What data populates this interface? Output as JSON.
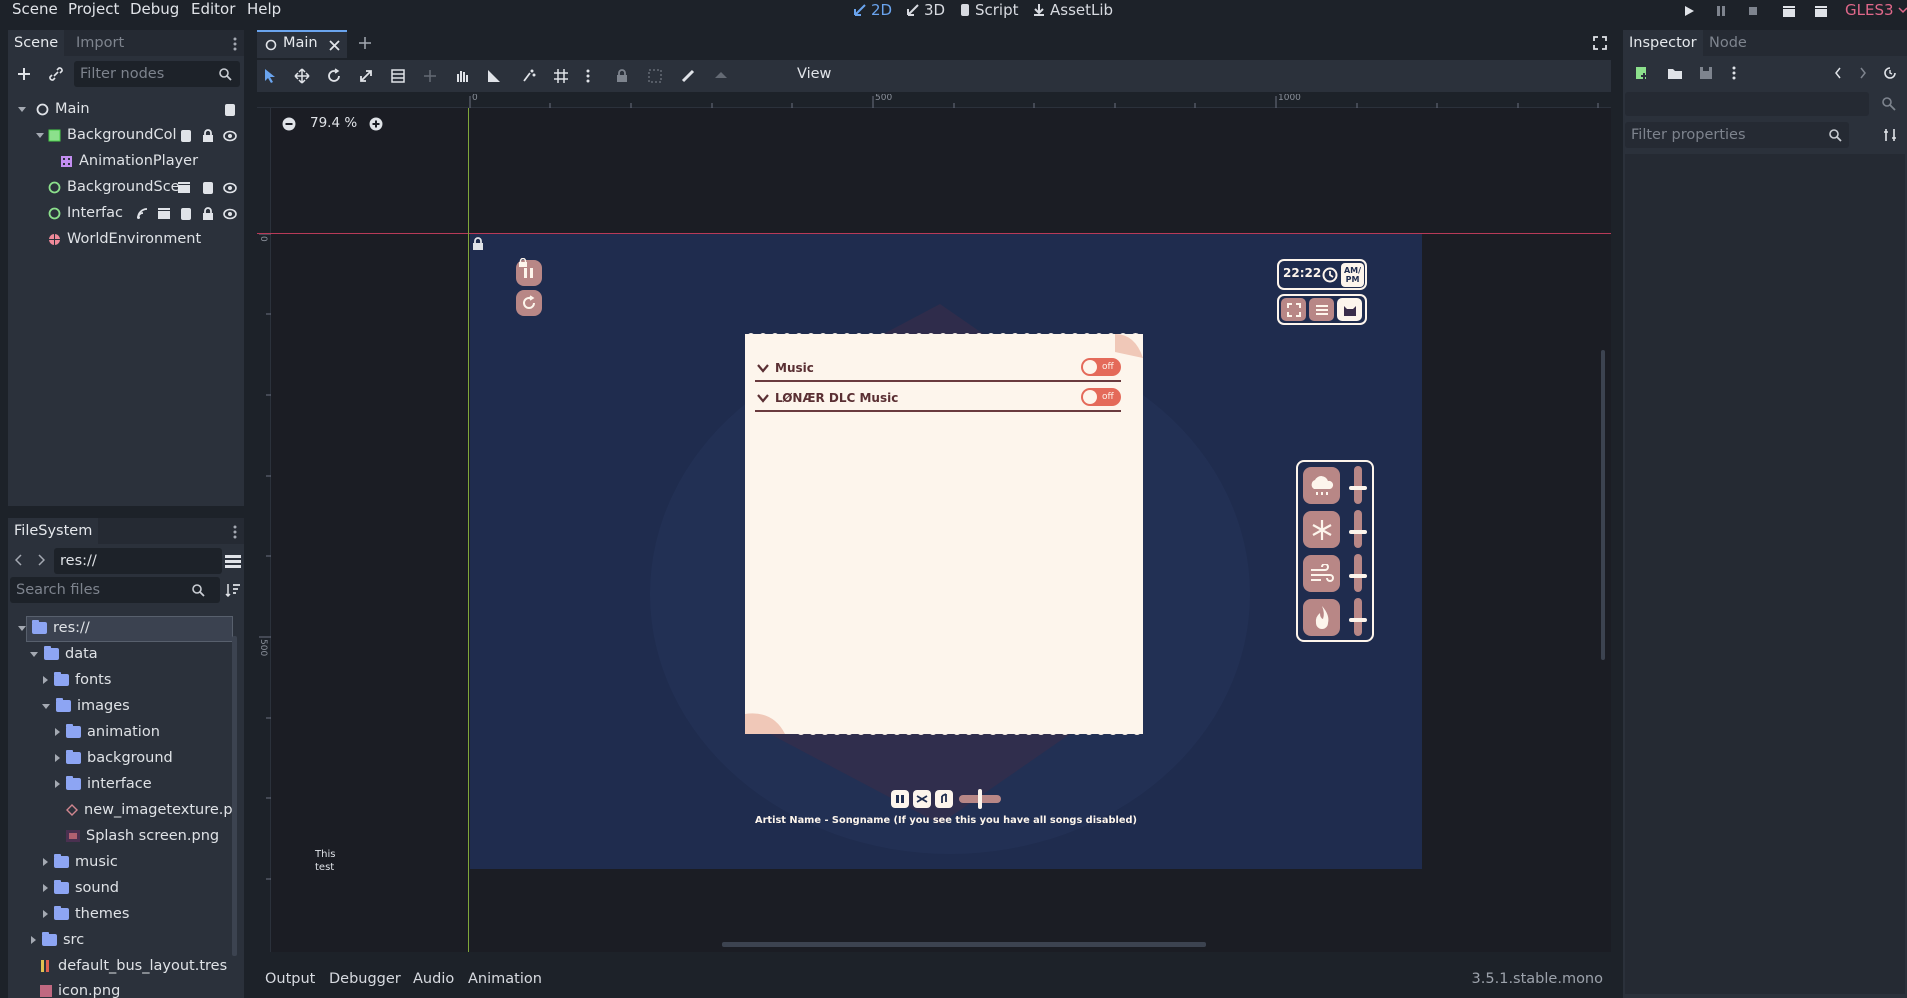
{
  "menu": [
    "Scene",
    "Project",
    "Debug",
    "Editor",
    "Help"
  ],
  "workspaces": [
    {
      "label": "2D",
      "active": true
    },
    {
      "label": "3D",
      "active": false
    },
    {
      "label": "Script",
      "active": false
    },
    {
      "label": "AssetLib",
      "active": false
    }
  ],
  "renderer": "GLES3",
  "scene_dock": {
    "tabs": [
      "Scene",
      "Import"
    ],
    "filter_placeholder": "Filter nodes",
    "nodes": [
      {
        "name": "Main",
        "icon": "node2d-circle-icon"
      },
      {
        "name": "BackgroundCol",
        "icon": "color-rect-icon"
      },
      {
        "name": "AnimationPlayer",
        "icon": "animation-player-icon"
      },
      {
        "name": "BackgroundSce",
        "icon": "control-circle-icon"
      },
      {
        "name": "Interfac",
        "icon": "control-circle-icon"
      },
      {
        "name": "WorldEnvironment",
        "icon": "world-environment-icon"
      }
    ]
  },
  "filesystem": {
    "tab": "FileSystem",
    "path": "res://",
    "search_placeholder": "Search files",
    "items": [
      "res://",
      "data",
      "fonts",
      "images",
      "animation",
      "background",
      "interface",
      "new_imagetexture.p",
      "Splash screen.png",
      "music",
      "sound",
      "themes",
      "src",
      "default_bus_layout.tres",
      "icon.png"
    ]
  },
  "editor": {
    "tab": "Main",
    "view_menu": "View",
    "zoom": "79.4 %",
    "ruler_labels": [
      "0",
      "500",
      "1000"
    ],
    "left_ruler_labels": [
      "0",
      "500"
    ],
    "test_label": [
      "This",
      "test"
    ]
  },
  "game": {
    "clock": "22:22",
    "ampm": "AM/\nPM",
    "playlist": [
      {
        "label": "Music",
        "toggle": "off"
      },
      {
        "label": "LØNÆR DLC Music",
        "toggle": "off"
      }
    ],
    "now_playing": "Artist Name - Songname (If you see this you have all songs disabled)",
    "weather": [
      {
        "icon": "rain-cloud-icon",
        "level": 0.5
      },
      {
        "icon": "snowflake-icon",
        "level": 0.5
      },
      {
        "icon": "wind-icon",
        "level": 0.5
      },
      {
        "icon": "fire-icon",
        "level": 0.5
      }
    ],
    "volume": 0.5
  },
  "inspector": {
    "tabs": [
      "Inspector",
      "Node"
    ],
    "filter_placeholder": "Filter properties"
  },
  "bottom_panel": {
    "tabs": [
      "Output",
      "Debugger",
      "Audio",
      "Animation"
    ],
    "version": "3.5.1.stable.mono"
  },
  "colors": {
    "accent": "#6aa4ee",
    "game_bg": "#1f2c4e",
    "paper": "#fdf5ec",
    "toggle": "#e46a5a",
    "widget": "#b88786",
    "renderer": "#e0688a"
  }
}
